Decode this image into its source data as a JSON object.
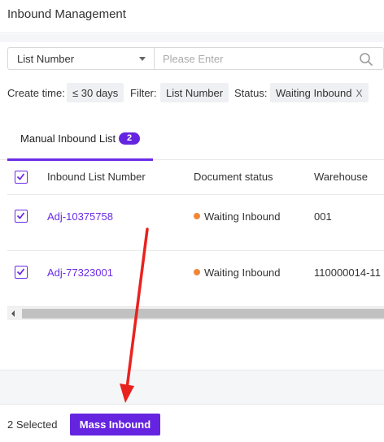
{
  "header": {
    "title": "Inbound Management"
  },
  "search": {
    "field_selected": "List Number",
    "placeholder": "Please Enter",
    "value": ""
  },
  "filters": {
    "create_time_label": "Create time:",
    "create_time_value": "≤ 30 days",
    "filter_label": "Filter:",
    "filter_value": "List Number",
    "status_label": "Status:",
    "status_value": "Waiting Inbound",
    "remove_symbol": "X"
  },
  "tabs": [
    {
      "label": "Manual Inbound List",
      "count": "2",
      "active": true
    }
  ],
  "table": {
    "columns": [
      "Inbound List Number",
      "Document status",
      "Warehouse"
    ],
    "rows": [
      {
        "number": "Adj-10375758",
        "status": "Waiting Inbound",
        "warehouse": "001",
        "checked": true
      },
      {
        "number": "Adj-77323001",
        "status": "Waiting Inbound",
        "warehouse": "110000014-11",
        "checked": true
      }
    ],
    "status_color": "#f0883a"
  },
  "footer": {
    "selected_text": "2 Selected",
    "mass_button_label": "Mass Inbound"
  },
  "colors": {
    "accent": "#6525e0",
    "annotation_arrow": "#e8231f"
  },
  "icons": {
    "search": "search-icon",
    "checkbox": "checkbox-checked-icon",
    "annotation": "red-arrow-icon"
  }
}
